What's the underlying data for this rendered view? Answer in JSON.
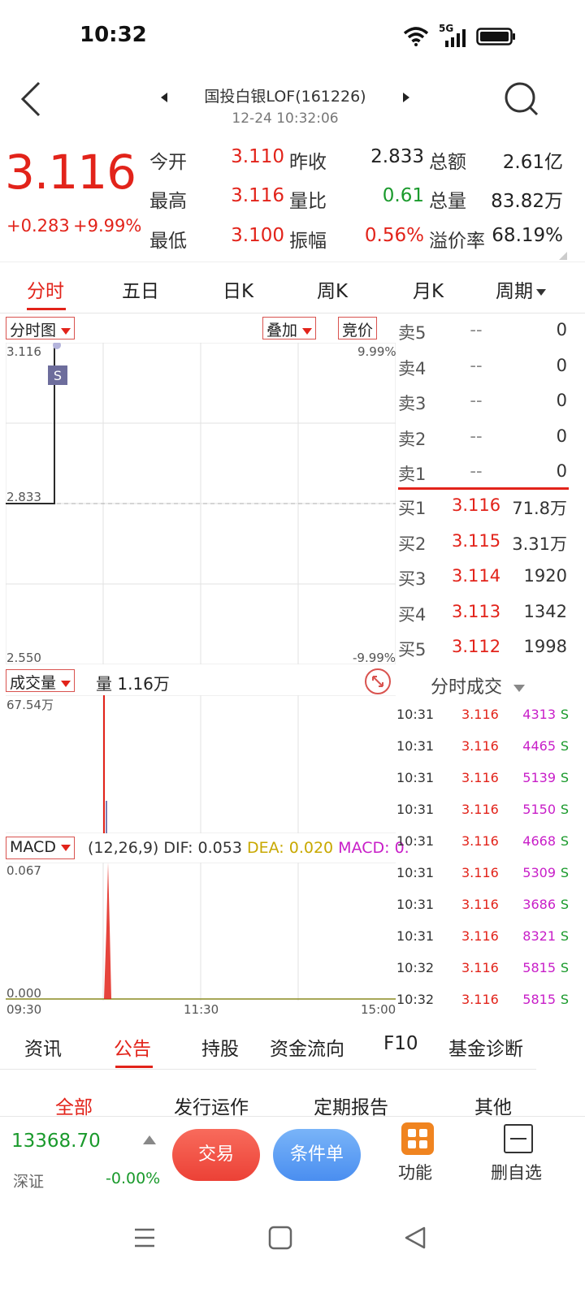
{
  "status_bar": {
    "time": "10:32",
    "network": "5G"
  },
  "header": {
    "title": "国投白银LOF(161226)",
    "datetime": "12-24 10:32:06"
  },
  "quote": {
    "price": "3.116",
    "change": "+0.283",
    "change_pct": "+9.99%",
    "fields": [
      {
        "label": "今开",
        "value": "3.110",
        "color": "#e2231a"
      },
      {
        "label": "昨收",
        "value": "2.833",
        "color": "#222222"
      },
      {
        "label": "总额",
        "value": "2.61亿",
        "color": "#222222"
      },
      {
        "label": "最高",
        "value": "3.116",
        "color": "#e2231a"
      },
      {
        "label": "量比",
        "value": "0.61",
        "color": "#1a9a2c"
      },
      {
        "label": "总量",
        "value": "83.82万",
        "color": "#222222"
      },
      {
        "label": "最低",
        "value": "3.100",
        "color": "#e2231a"
      },
      {
        "label": "振幅",
        "value": "0.56%",
        "color": "#e2231a"
      },
      {
        "label": "溢价率",
        "value": "68.19%",
        "color": "#222222"
      }
    ]
  },
  "period_tabs": [
    {
      "label": "分时",
      "active": true
    },
    {
      "label": "五日",
      "active": false
    },
    {
      "label": "日K",
      "active": false
    },
    {
      "label": "周K",
      "active": false
    },
    {
      "label": "月K",
      "active": false
    },
    {
      "label": "周期",
      "active": false,
      "dropdown": true
    }
  ],
  "chart": {
    "type_chip": "分时图",
    "overlay_chip": "叠加",
    "auction_chip": "竞价",
    "y_top": "3.116",
    "y_mid": "2.833",
    "y_bottom": "2.550",
    "pct_top": "9.99%",
    "pct_bottom": "-9.99%",
    "marker": "S",
    "volume_chip": "成交量",
    "volume_label": "量 1.16万",
    "volume_max": "67.54万",
    "macd_chip": "MACD",
    "macd_params": "(12,26,9)",
    "macd_dif": "DIF: 0.053",
    "macd_dea": "DEA: 0.020",
    "macd_macd": "MACD: 0.",
    "macd_top": "0.067",
    "macd_bottom": "0.000",
    "x_start": "09:30",
    "x_mid": "11:30",
    "x_end": "15:00"
  },
  "chart_data": {
    "type": "line",
    "title": "",
    "xlabel": "",
    "ylabel": "",
    "x_ticks": [
      "09:30",
      "11:30",
      "15:00"
    ],
    "ylim": [
      2.55,
      3.116
    ],
    "series": [
      {
        "x": [
          "09:30",
          "10:00",
          "10:00",
          "10:02"
        ],
        "values": [
          2.833,
          2.833,
          3.116,
          3.116
        ]
      }
    ],
    "grid": true
  },
  "order_book": {
    "asks": [
      {
        "label": "卖5",
        "price": "--",
        "volume": "0"
      },
      {
        "label": "卖4",
        "price": "--",
        "volume": "0"
      },
      {
        "label": "卖3",
        "price": "--",
        "volume": "0"
      },
      {
        "label": "卖2",
        "price": "--",
        "volume": "0"
      },
      {
        "label": "卖1",
        "price": "--",
        "volume": "0"
      }
    ],
    "bids": [
      {
        "label": "买1",
        "price": "3.116",
        "volume": "71.8万"
      },
      {
        "label": "买2",
        "price": "3.115",
        "volume": "3.31万"
      },
      {
        "label": "买3",
        "price": "3.114",
        "volume": "1920"
      },
      {
        "label": "买4",
        "price": "3.113",
        "volume": "1342"
      },
      {
        "label": "买5",
        "price": "3.112",
        "volume": "1998"
      }
    ]
  },
  "ticks": {
    "header": "分时成交",
    "rows": [
      {
        "time": "10:31",
        "price": "3.116",
        "volume": "4313",
        "side": "S"
      },
      {
        "time": "10:31",
        "price": "3.116",
        "volume": "4465",
        "side": "S"
      },
      {
        "time": "10:31",
        "price": "3.116",
        "volume": "5139",
        "side": "S"
      },
      {
        "time": "10:31",
        "price": "3.116",
        "volume": "5150",
        "side": "S"
      },
      {
        "time": "10:31",
        "price": "3.116",
        "volume": "4668",
        "side": "S"
      },
      {
        "time": "10:31",
        "price": "3.116",
        "volume": "5309",
        "side": "S"
      },
      {
        "time": "10:31",
        "price": "3.116",
        "volume": "3686",
        "side": "S"
      },
      {
        "time": "10:31",
        "price": "3.116",
        "volume": "8321",
        "side": "S"
      },
      {
        "time": "10:32",
        "price": "3.116",
        "volume": "5815",
        "side": "S"
      },
      {
        "time": "10:32",
        "price": "3.116",
        "volume": "5815",
        "side": "S"
      }
    ]
  },
  "bottom_tabs": [
    "资讯",
    "公告",
    "持股",
    "资金流向",
    "F10",
    "基金诊断"
  ],
  "sub_tabs": [
    "全部",
    "发行运作",
    "定期报告",
    "其他"
  ],
  "footer": {
    "index_value": "13368.70",
    "index_name": "深证",
    "index_pct": "-0.00%",
    "trade_label": "交易",
    "condition_label": "条件单",
    "function_label": "功能",
    "favorite_label": "删自选"
  },
  "colors": {
    "up": "#e2231a",
    "down": "#1a9a2c",
    "accent": "#e2231a"
  }
}
